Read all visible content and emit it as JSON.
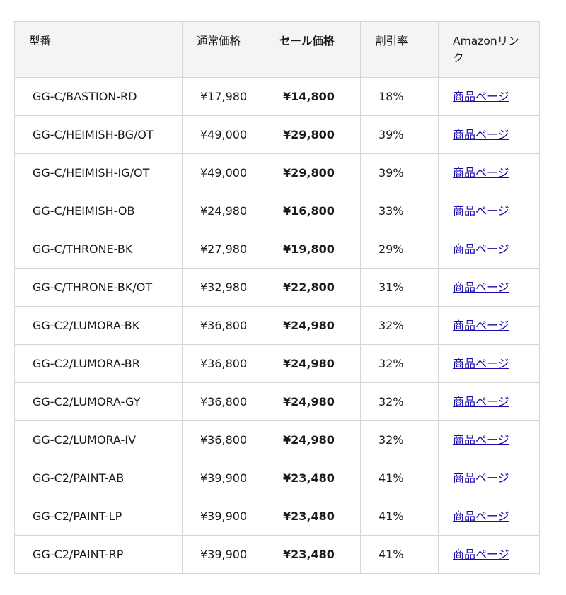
{
  "table": {
    "headers": [
      "型番",
      "通常価格",
      "セール価格",
      "割引率",
      "Amazonリンク"
    ],
    "rows": [
      {
        "model": "GG-C/BASTION-RD",
        "regular": "¥17,980",
        "sale": "¥14,800",
        "discount": "18%",
        "link": "商品ページ"
      },
      {
        "model": "GG-C/HEIMISH-BG/OT",
        "regular": "¥49,000",
        "sale": "¥29,800",
        "discount": "39%",
        "link": "商品ページ"
      },
      {
        "model": "GG-C/HEIMISH-IG/OT",
        "regular": "¥49,000",
        "sale": "¥29,800",
        "discount": "39%",
        "link": "商品ページ"
      },
      {
        "model": "GG-C/HEIMISH-OB",
        "regular": "¥24,980",
        "sale": "¥16,800",
        "discount": "33%",
        "link": "商品ページ"
      },
      {
        "model": "GG-C/THRONE-BK",
        "regular": "¥27,980",
        "sale": "¥19,800",
        "discount": "29%",
        "link": "商品ページ"
      },
      {
        "model": "GG-C/THRONE-BK/OT",
        "regular": "¥32,980",
        "sale": "¥22,800",
        "discount": "31%",
        "link": "商品ページ"
      },
      {
        "model": "GG-C2/LUMORA-BK",
        "regular": "¥36,800",
        "sale": "¥24,980",
        "discount": "32%",
        "link": "商品ページ"
      },
      {
        "model": "GG-C2/LUMORA-BR",
        "regular": "¥36,800",
        "sale": "¥24,980",
        "discount": "32%",
        "link": "商品ページ"
      },
      {
        "model": "GG-C2/LUMORA-GY",
        "regular": "¥36,800",
        "sale": "¥24,980",
        "discount": "32%",
        "link": "商品ページ"
      },
      {
        "model": "GG-C2/LUMORA-IV",
        "regular": "¥36,800",
        "sale": "¥24,980",
        "discount": "32%",
        "link": "商品ページ"
      },
      {
        "model": "GG-C2/PAINT-AB",
        "regular": "¥39,900",
        "sale": "¥23,480",
        "discount": "41%",
        "link": "商品ページ"
      },
      {
        "model": "GG-C2/PAINT-LP",
        "regular": "¥39,900",
        "sale": "¥23,480",
        "discount": "41%",
        "link": "商品ページ"
      },
      {
        "model": "GG-C2/PAINT-RP",
        "regular": "¥39,900",
        "sale": "¥23,480",
        "discount": "41%",
        "link": "商品ページ"
      }
    ]
  },
  "colors": {
    "header_bg": "#f4f4f4",
    "border": "#d6d6d6",
    "link": "#1a0dab"
  }
}
